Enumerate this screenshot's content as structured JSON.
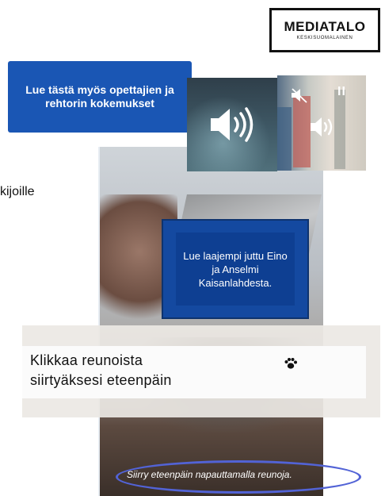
{
  "logo": {
    "name": "MEDIATALO",
    "subtitle": "KESKISUOMALAINEN"
  },
  "left_text": "kijoille",
  "links": {
    "teachers": "Lue tästä myös opettajien ja rehtorin kokemukset",
    "story": "Lue laajempi juttu Eino ja Anselmi Kaisanlahdesta."
  },
  "audio": {
    "speaker_icon": "speaker-icon",
    "mute_icon": "mute-icon",
    "pause_icon": "pause-icon",
    "pause_symbol": "II"
  },
  "banner": {
    "line1": "Klikkaa reunoista",
    "line2": "siirtyäksesi eteenpäin",
    "icon": "paw-icon"
  },
  "caption": "Siirry eteenpäin napauttamalla reunoja.",
  "colors": {
    "link_blue": "#1a56b4",
    "link_blue_dark": "#0e3f92",
    "oval": "#5263d6"
  }
}
